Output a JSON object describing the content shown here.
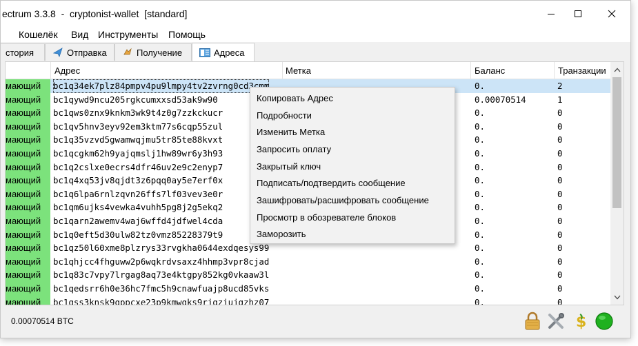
{
  "window": {
    "title": "ectrum 3.3.8  -  cryptonist-wallet  [standard]",
    "controls": [
      "minimize",
      "maximize",
      "close"
    ]
  },
  "menu": [
    "Кошелёк",
    "Вид",
    "Инструменты",
    "Помощь"
  ],
  "tabs": [
    {
      "label": "стория",
      "icon": "history-icon",
      "active": false
    },
    {
      "label": "Отправка",
      "icon": "send-icon",
      "active": false
    },
    {
      "label": "Получение",
      "icon": "receive-icon",
      "active": false
    },
    {
      "label": "Адреса",
      "icon": "addresses-icon",
      "active": true
    }
  ],
  "table": {
    "headers": [
      "Адрес",
      "Метка",
      "Баланс",
      "Транзакции"
    ],
    "rows": [
      {
        "type": "мающий",
        "address": "bc1q34ek7plz84pmpv4pu9lmpy4tv2zvrng0cd3cmm",
        "label": "",
        "balance": "0.",
        "tx": "2",
        "selected": true
      },
      {
        "type": "мающий",
        "address": "bc1qywd9ncu205rgkcumxxsd53ak9w90",
        "label": "",
        "balance": "0.00070514",
        "tx": "1",
        "selected": false
      },
      {
        "type": "мающий",
        "address": "bc1qws0znx9knkm3wk9t4z0g7zzkckucr",
        "label": "",
        "balance": "0.",
        "tx": "0",
        "selected": false
      },
      {
        "type": "мающий",
        "address": "bc1qv5hnv3eyv92em3ktm77s6cqp55zul",
        "label": "",
        "balance": "0.",
        "tx": "0",
        "selected": false
      },
      {
        "type": "мающий",
        "address": "bc1q35vzvd5gwamwqjmu5tr85te88kvxt",
        "label": "",
        "balance": "0.",
        "tx": "0",
        "selected": false
      },
      {
        "type": "мающий",
        "address": "bc1qcgkm62h9yajqmslj1hw89wr6y3h93",
        "label": "",
        "balance": "0.",
        "tx": "0",
        "selected": false
      },
      {
        "type": "мающий",
        "address": "bc1q2cslxe0ecrs4dfr46uv2e9c2enyp7",
        "label": "",
        "balance": "0.",
        "tx": "0",
        "selected": false
      },
      {
        "type": "мающий",
        "address": "bc1q4xq53jv8qjdt3z6pqq0ay5e7erf0x",
        "label": "",
        "balance": "0.",
        "tx": "0",
        "selected": false
      },
      {
        "type": "мающий",
        "address": "bc1q6lpa6rnlzqvn26ffs7lf03vev3e0r",
        "label": "",
        "balance": "0.",
        "tx": "0",
        "selected": false
      },
      {
        "type": "мающий",
        "address": "bc1qm6ujks4vewka4vuhh5pg8j2g5ekq2",
        "label": "",
        "balance": "0.",
        "tx": "0",
        "selected": false
      },
      {
        "type": "мающий",
        "address": "bc1qarn2awemv4waj6wffd4jdfwel4cda",
        "label": "",
        "balance": "0.",
        "tx": "0",
        "selected": false
      },
      {
        "type": "мающий",
        "address": "bc1q0eft5d30ulw82tz0vmz85228379t9",
        "label": "",
        "balance": "0.",
        "tx": "0",
        "selected": false
      },
      {
        "type": "мающий",
        "address": "bc1qz50l60xme8plzrys33rvgkha0644exdqesys99",
        "label": "",
        "balance": "0.",
        "tx": "0",
        "selected": false
      },
      {
        "type": "мающий",
        "address": "bc1qhjcc4fhguww2p6wqkrdvsaxz4hhmp3vpr8cjad",
        "label": "",
        "balance": "0.",
        "tx": "0",
        "selected": false
      },
      {
        "type": "мающий",
        "address": "bc1q83c7vpy7lrgag8aq73e4ktgpy852kg0vkaaw3l",
        "label": "",
        "balance": "0.",
        "tx": "0",
        "selected": false
      },
      {
        "type": "мающий",
        "address": "bc1qedsrr6h0e36hc7fmc5h9cnawfuajp8ucd85vks",
        "label": "",
        "balance": "0.",
        "tx": "0",
        "selected": false
      },
      {
        "type": "мающий",
        "address": "bc1qss3knsk9qppcxe23p9kmwqks9rjqzjujqzhz07",
        "label": "",
        "balance": "0.",
        "tx": "0",
        "selected": false
      }
    ]
  },
  "context_menu": [
    "Копировать Адрес",
    "Подробности",
    "Изменить Метка",
    "Запросить оплату",
    "Закрытый ключ",
    "Подписать/подтвердить сообщение",
    "Зашифровать/расшифровать сообщение",
    "Просмотр в обозревателе блоков",
    "Заморозить"
  ],
  "status": {
    "balance": "0.00070514 BTC",
    "icons": [
      "lock-icon",
      "preferences-icon",
      "seed-icon",
      "network-status-icon"
    ],
    "network_color": "#1fb11f"
  },
  "colors": {
    "receiving_green": "#7ce27c",
    "selection_blue": "#cce4f7"
  }
}
